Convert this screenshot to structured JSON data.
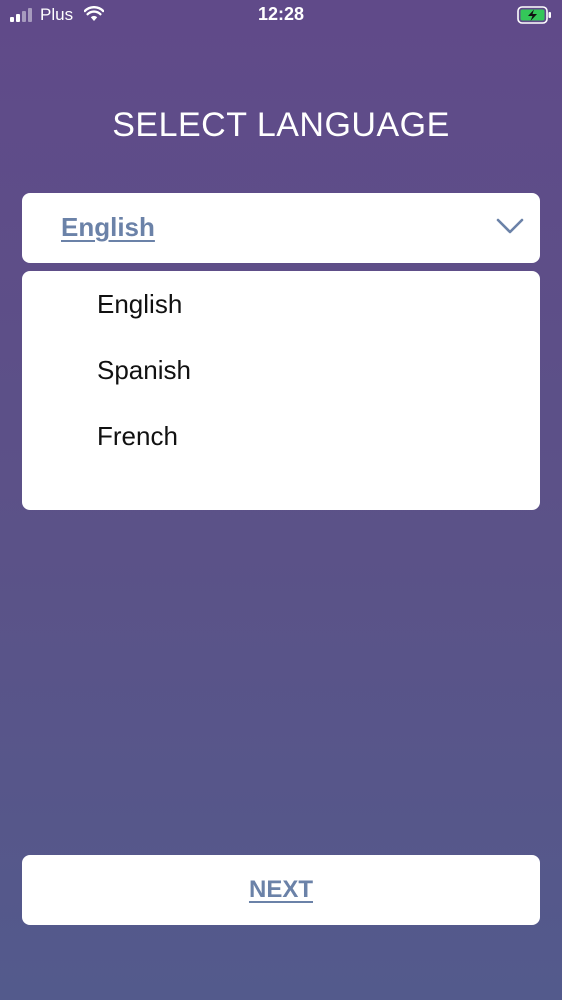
{
  "status_bar": {
    "carrier": "Plus",
    "time": "12:28",
    "icons": [
      "signal-icon",
      "wifi-icon",
      "battery-charging-icon"
    ]
  },
  "title": "SELECT LANGUAGE",
  "language_select": {
    "selected": "English",
    "icon": "chevron-down-icon",
    "options": [
      "English",
      "Spanish",
      "French"
    ]
  },
  "next_button": {
    "label": "NEXT"
  },
  "colors": {
    "background_top": "#604a89",
    "background_bottom": "#535a8c",
    "accent_text": "#6b82a8",
    "battery_fill": "#34c759"
  }
}
